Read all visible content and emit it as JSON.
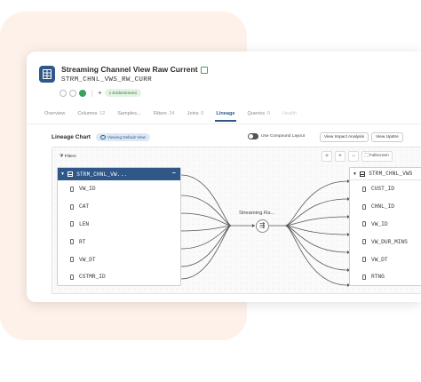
{
  "asset": {
    "title": "Streaming Channel View Raw Current",
    "subtitle": "STRM_CHNL_VWS_RW_CURR",
    "endorsement": "1 Endorsement"
  },
  "tabs": [
    {
      "label": "Overview",
      "count": ""
    },
    {
      "label": "Columns",
      "count": "12"
    },
    {
      "label": "Samples...",
      "count": ""
    },
    {
      "label": "Filters",
      "count": "24"
    },
    {
      "label": "Joins",
      "count": "0"
    },
    {
      "label": "Lineage",
      "count": ""
    },
    {
      "label": "Queries",
      "count": "0"
    },
    {
      "label": "Health",
      "count": ""
    }
  ],
  "lineage": {
    "title": "Lineage Chart",
    "viewing_pill": "Viewing Default View",
    "compound_label": "Use Compound Layout",
    "impact_button": "View Impact Analysis",
    "upstream_button": "View Upstre",
    "filters_label": "Filters",
    "fullscreen_label": "Fullscreen",
    "process_label": "Streaming Ra...",
    "left_node": {
      "name": "STRM_CHNL_VW...",
      "fields": [
        "VW_ID",
        "CAT",
        "LEN",
        "RT",
        "VW_DT",
        "CSTMR_ID"
      ]
    },
    "right_node": {
      "name": "STRM_CHNL_VWS",
      "fields": [
        "CUST_ID",
        "CHNL_ID",
        "VW_ID",
        "VW_DUR_MINS",
        "VW_DT",
        "RTNG"
      ]
    }
  },
  "colors": {
    "brand": "#2f5889",
    "endorse_bg": "#e4f3e5",
    "accent_green": "#3aa35b",
    "backdrop": "#fdf1ea"
  }
}
